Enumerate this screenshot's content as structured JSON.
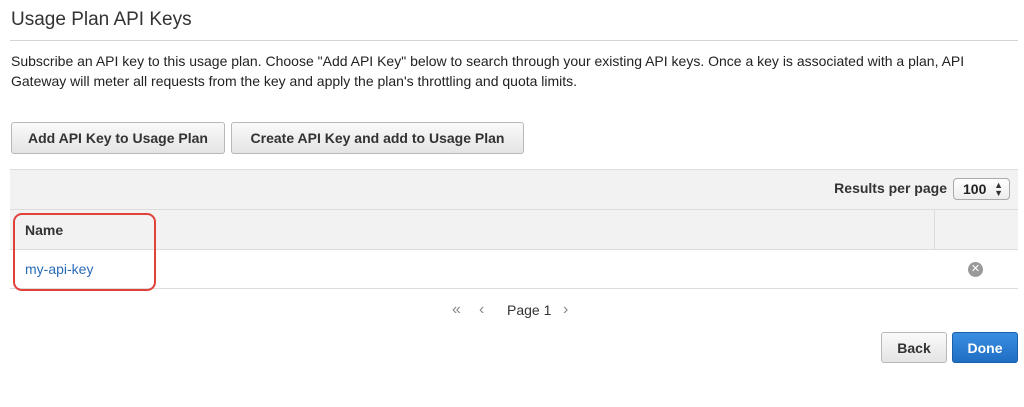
{
  "page": {
    "title": "Usage Plan API Keys",
    "description": "Subscribe an API key to this usage plan. Choose \"Add API Key\" below to search through your existing API keys. Once a key is associated with a plan, API Gateway will meter all requests from the key and apply the plan's throttling and quota limits."
  },
  "actions": {
    "add_label": "Add API Key to Usage Plan",
    "create_label": "Create API Key and add to Usage Plan"
  },
  "table": {
    "results_per_page_label": "Results per page",
    "results_per_page_value": "100",
    "columns": [
      "Name"
    ],
    "rows": [
      {
        "name": "my-api-key"
      }
    ]
  },
  "pagination": {
    "first_icon": "«",
    "prev_icon": "‹",
    "label": "Page 1",
    "next_icon": "›"
  },
  "footer": {
    "back_label": "Back",
    "done_label": "Done"
  },
  "colors": {
    "link": "#2a6bb8",
    "primary": "#1f6fc4",
    "highlight": "#e0413a"
  }
}
